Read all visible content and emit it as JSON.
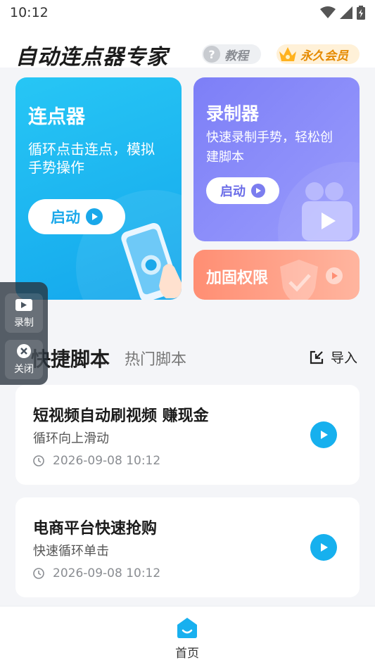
{
  "status_bar": {
    "time": "10:12"
  },
  "header": {
    "app_title": "自动连点器专家",
    "tutorial_label": "教程",
    "vip_label": "永久会员"
  },
  "cards": {
    "clicker": {
      "title": "连点器",
      "desc_line1": "循环点击连点，模拟",
      "desc_line2": "手势操作",
      "button_label": "启动"
    },
    "recorder": {
      "title": "录制器",
      "desc_line1": "快速录制手势，轻松创",
      "desc_line2": "建脚本",
      "button_label": "启动"
    },
    "reinforce": {
      "title": "加固权限"
    }
  },
  "float_widget": {
    "record_label": "录制",
    "close_label": "关闭"
  },
  "section": {
    "tab_quick": "快捷脚本",
    "tab_hot": "热门脚本",
    "import_label": "导入"
  },
  "scripts": [
    {
      "title": "短视频自动刷视频 赚现金",
      "desc": "循环向上滑动",
      "time": "2026-09-08 10:12"
    },
    {
      "title": "电商平台快速抢购",
      "desc": "快速循环单击",
      "time": "2026-09-08 10:12"
    }
  ],
  "bottom_nav": {
    "home_label": "首页"
  },
  "colors": {
    "accent_blue": "#16b0ee",
    "recorder_purple": "#8587f9",
    "reinforce_orange": "#ff9a80",
    "vip_orange": "#e58a00"
  }
}
